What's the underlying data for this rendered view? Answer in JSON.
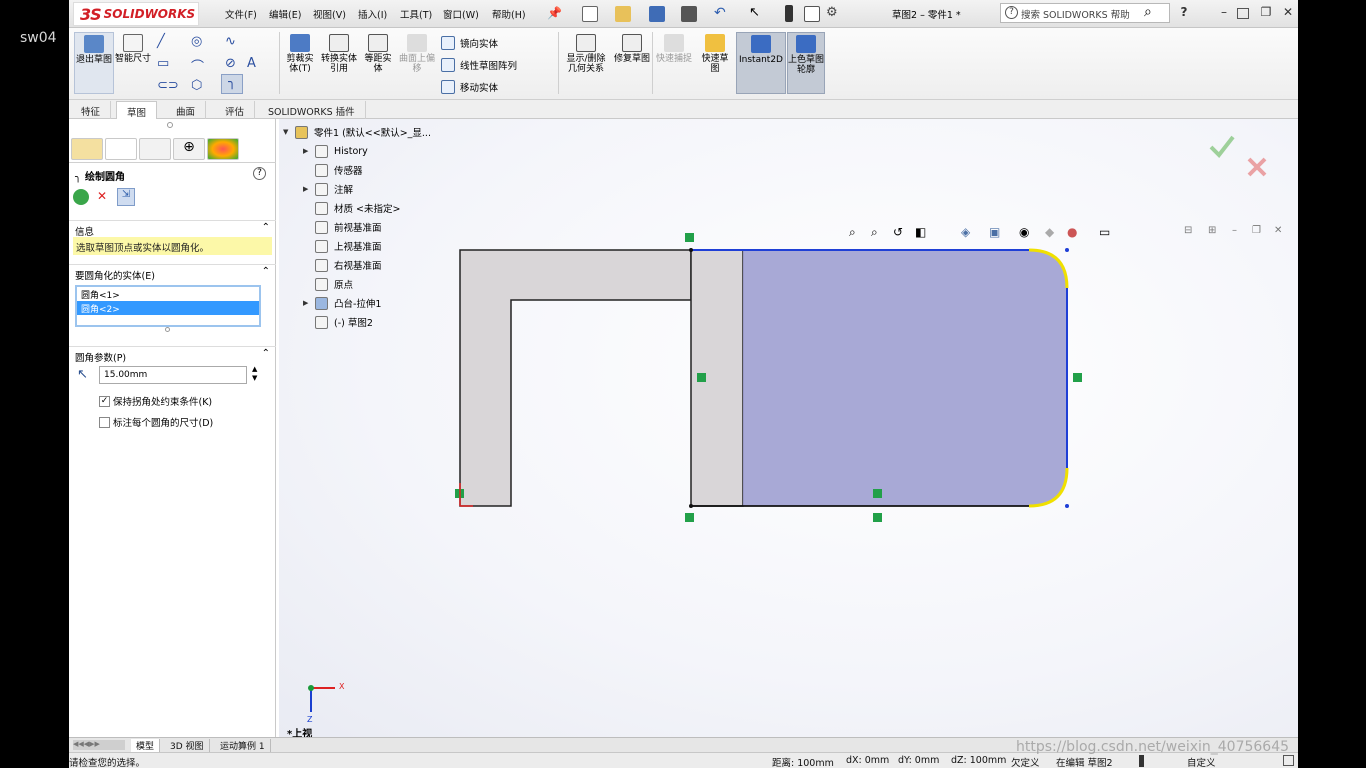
{
  "overlay": {
    "video_title": "sw04",
    "watermark": "https://blog.csdn.net/weixin_40756645"
  },
  "app": {
    "logo_text": "SOLIDWORKS",
    "logo_mark": "3S"
  },
  "menu": [
    "文件(F)",
    "编辑(E)",
    "视图(V)",
    "插入(I)",
    "工具(T)",
    "窗口(W)",
    "帮助(H)"
  ],
  "title": {
    "document": "草图2 – 零件1 *",
    "search_placeholder": "搜索 SOLIDWORKS 帮助"
  },
  "ribbon": {
    "exit_sketch": "退出草图",
    "smart_dim": "智能尺寸",
    "trim": "剪裁实体(T)",
    "convert": "转换实体引用",
    "offset": "等距实体",
    "offset_on_surface": "曲面上偏移",
    "mirror": "镜向实体",
    "linear_pattern": "线性草图阵列",
    "move": "移动实体",
    "relations": "显示/删除几何关系",
    "repair": "修复草图",
    "quick_snaps": "快速捕捉",
    "rapid_sketch": "快速草图",
    "instant2d": "Instant2D",
    "shaded_contours": "上色草图轮廓"
  },
  "tabs": [
    "特征",
    "草图",
    "曲面",
    "评估",
    "SOLIDWORKS 插件"
  ],
  "active_tab": "草图",
  "property_manager": {
    "title": "绘制圆角",
    "info_header": "信息",
    "info_msg": "选取草图顶点或实体以圆角化。",
    "entities_header": "要圆角化的实体(E)",
    "entities": [
      "圆角<1>",
      "圆角<2>"
    ],
    "params_header": "圆角参数(P)",
    "radius": "15.00mm",
    "keep_constraints": "保持拐角处约束条件(K)",
    "keep_constraints_checked": true,
    "dimension_each": "标注每个圆角的尺寸(D)",
    "dimension_each_checked": false
  },
  "tree": {
    "root": "零件1 (默认<<默认>_显...",
    "items": [
      "History",
      "传感器",
      "注解",
      "材质 <未指定>",
      "前视基准面",
      "上视基准面",
      "右视基准面",
      "原点",
      "凸台-拉伸1",
      "(-) 草图2"
    ]
  },
  "view": {
    "orientation": "*上视",
    "axis_x": "X",
    "axis_z": "Z"
  },
  "bottom_tabs": [
    "模型",
    "3D 视图",
    "运动算例 1"
  ],
  "status": {
    "message": "请检查您的选择。",
    "distance": "距离: 100mm",
    "dx": "dX: 0mm",
    "dy": "dY: 0mm",
    "dz": "dZ: 100mm",
    "state": "欠定义",
    "editing": "在编辑 草图2",
    "units": "自定义"
  },
  "colors": {
    "accent_blue": "#1f3fd6",
    "fillet_yellow": "#f0e000",
    "part_gray": "#d9d6d8",
    "sketch_fill": "#9fa0d2"
  }
}
